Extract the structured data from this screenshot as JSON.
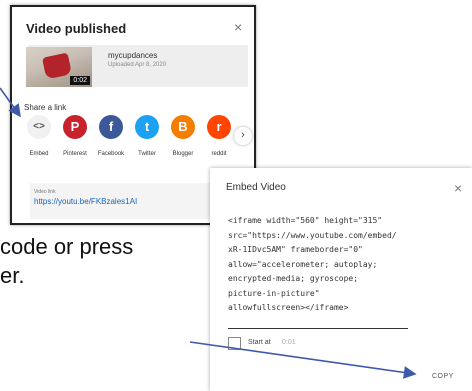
{
  "doc": {
    "line1": "code or press",
    "line2": "er."
  },
  "video_published": {
    "title": "Video published",
    "close": "×",
    "thumbnail_duration": "0:02",
    "channel": "mycupdances",
    "uploaded": "Uploaded Apr 8, 2020",
    "share_label": "Share a link",
    "share_items": [
      {
        "label": "Embed",
        "glyph": "<>",
        "color": "#f1f1f1",
        "icon": "embed-icon"
      },
      {
        "label": "Pinterest",
        "glyph": "P",
        "color": "#c8232c",
        "icon": "pinterest-icon"
      },
      {
        "label": "Facebook",
        "glyph": "f",
        "color": "#3b5998",
        "icon": "facebook-icon"
      },
      {
        "label": "Twitter",
        "glyph": "t",
        "color": "#1da1f2",
        "icon": "twitter-icon"
      },
      {
        "label": "Blogger",
        "glyph": "B",
        "color": "#f57d00",
        "icon": "blogger-icon"
      },
      {
        "label": "reddit",
        "glyph": "r",
        "color": "#ff4500",
        "icon": "reddit-icon"
      }
    ],
    "next": "›",
    "link_label": "Video link",
    "link_url": "https://youtu.be/FKBzales1AI"
  },
  "embed": {
    "title": "Embed Video",
    "close": "×",
    "code_lines": [
      "<iframe width=\"560\" height=\"315\"",
      "src=\"https://www.youtube.com/embed/",
      "xR-1IDvc5AM\" frameborder=\"0\"",
      "allow=\"accelerometer; autoplay;",
      "encrypted-media; gyroscope;",
      "picture-in-picture\"",
      "allowfullscreen></iframe>"
    ],
    "start_label": "Start at",
    "start_time": "0:01",
    "copy_label": "COPY"
  },
  "colors": {
    "arrow": "#3f5aa8",
    "link": "#1565c0"
  }
}
